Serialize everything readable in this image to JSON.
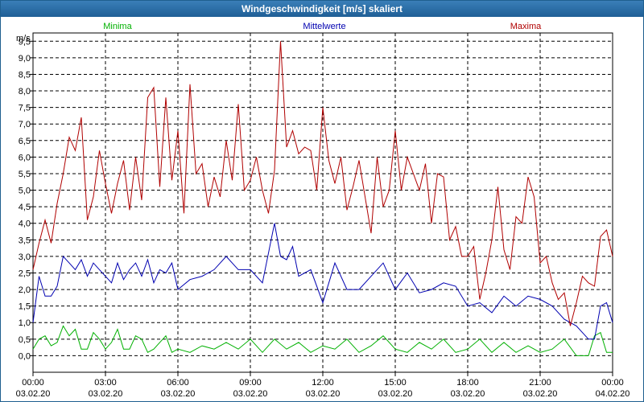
{
  "window": {
    "title": "Windgeschwindigkeit [m/s] skaliert"
  },
  "chart_data": {
    "type": "line",
    "title": "Windgeschwindigkeit [m/s] skaliert",
    "ylabel": "m/s",
    "xlabel": "",
    "ylim": [
      -0.5,
      9.75
    ],
    "xlim": [
      0,
      24
    ],
    "grid": true,
    "legend_placement": "top",
    "y_ticks": [
      "0,0",
      "0,5",
      "1,0",
      "1,5",
      "2,0",
      "2,5",
      "3,0",
      "3,5",
      "4,0",
      "4,5",
      "5,0",
      "5,5",
      "6,0",
      "6,5",
      "7,0",
      "7,5",
      "8,0",
      "8,5",
      "9,0",
      "9,5"
    ],
    "x_ticks": [
      {
        "time": "00:00",
        "date": "03.02.20"
      },
      {
        "time": "03:00",
        "date": "03.02.20"
      },
      {
        "time": "06:00",
        "date": "03.02.20"
      },
      {
        "time": "09:00",
        "date": "03.02.20"
      },
      {
        "time": "12:00",
        "date": "03.02.20"
      },
      {
        "time": "15:00",
        "date": "03.02.20"
      },
      {
        "time": "18:00",
        "date": "03.02.20"
      },
      {
        "time": "21:00",
        "date": "03.02.20"
      },
      {
        "time": "00:00",
        "date": "04.02.20"
      }
    ],
    "series": [
      {
        "name": "Minima",
        "color": "#00b000",
        "x": [
          0,
          0.25,
          0.5,
          0.75,
          1,
          1.25,
          1.5,
          1.75,
          2,
          2.25,
          2.5,
          2.75,
          3,
          3.25,
          3.5,
          3.75,
          4,
          4.25,
          4.5,
          4.75,
          5,
          5.25,
          5.5,
          5.75,
          6,
          6.5,
          7,
          7.5,
          8,
          8.5,
          9,
          9.5,
          10,
          10.5,
          11,
          11.5,
          12,
          12.5,
          13,
          13.5,
          14,
          14.5,
          15,
          15.5,
          16,
          16.5,
          17,
          17.5,
          18,
          18.5,
          19,
          19.5,
          20,
          20.5,
          21,
          21.5,
          22,
          22.5,
          23,
          23.25,
          23.5,
          23.75,
          24
        ],
        "y": [
          0.2,
          0.5,
          0.6,
          0.3,
          0.4,
          0.9,
          0.6,
          0.8,
          0.2,
          0.2,
          0.7,
          0.5,
          0.2,
          0.4,
          0.8,
          0.2,
          0.2,
          0.6,
          0.5,
          0.1,
          0.2,
          0.4,
          0.6,
          0.1,
          0.2,
          0.1,
          0.3,
          0.2,
          0.4,
          0.2,
          0.5,
          0.1,
          0.5,
          0.2,
          0.4,
          0.1,
          0.3,
          0.2,
          0.5,
          0.1,
          0.3,
          0.6,
          0.2,
          0.1,
          0.4,
          0.2,
          0.5,
          0.1,
          0.2,
          0.5,
          0.1,
          0.4,
          0.1,
          0.3,
          0.1,
          0.2,
          0.5,
          0.0,
          0.0,
          0.6,
          0.7,
          0.1,
          0.1
        ]
      },
      {
        "name": "Mittelwerte",
        "color": "#0000b0",
        "x": [
          0,
          0.25,
          0.5,
          0.75,
          1,
          1.25,
          1.5,
          1.75,
          2,
          2.25,
          2.5,
          2.75,
          3,
          3.25,
          3.5,
          3.75,
          4,
          4.25,
          4.5,
          4.75,
          5,
          5.25,
          5.5,
          5.75,
          6,
          6.5,
          7,
          7.5,
          8,
          8.5,
          9,
          9.5,
          10,
          10.25,
          10.5,
          10.75,
          11,
          11.5,
          12,
          12.5,
          13,
          13.5,
          14,
          14.5,
          15,
          15.5,
          16,
          16.5,
          17,
          17.5,
          18,
          18.5,
          19,
          19.5,
          20,
          20.5,
          21,
          21.5,
          22,
          22.5,
          23,
          23.25,
          23.5,
          23.75,
          24
        ],
        "y": [
          1.0,
          2.4,
          1.8,
          1.8,
          2.1,
          3.0,
          2.8,
          2.6,
          2.9,
          2.4,
          2.8,
          2.6,
          2.4,
          2.2,
          2.8,
          2.3,
          2.6,
          2.8,
          2.4,
          2.9,
          2.2,
          2.6,
          2.5,
          2.8,
          2.0,
          2.3,
          2.4,
          2.6,
          3.0,
          2.6,
          2.6,
          2.2,
          4.0,
          3.0,
          2.9,
          3.3,
          2.4,
          2.6,
          1.6,
          2.8,
          2.0,
          2.0,
          2.4,
          2.8,
          2.0,
          2.5,
          1.9,
          2.0,
          2.2,
          2.1,
          1.5,
          1.6,
          1.3,
          1.8,
          1.5,
          1.8,
          1.7,
          1.5,
          1.1,
          0.9,
          0.5,
          0.5,
          1.5,
          1.6,
          1.0
        ]
      },
      {
        "name": "Maxima",
        "color": "#b00000",
        "x": [
          0,
          0.25,
          0.5,
          0.75,
          1,
          1.25,
          1.5,
          1.75,
          2,
          2.25,
          2.5,
          2.75,
          3,
          3.25,
          3.5,
          3.75,
          4,
          4.25,
          4.5,
          4.75,
          5,
          5.25,
          5.5,
          5.75,
          6,
          6.25,
          6.5,
          6.75,
          7,
          7.25,
          7.5,
          7.75,
          8,
          8.25,
          8.5,
          8.75,
          9,
          9.25,
          9.5,
          9.75,
          10,
          10.25,
          10.5,
          10.75,
          11,
          11.25,
          11.5,
          11.75,
          12,
          12.25,
          12.5,
          12.75,
          13,
          13.25,
          13.5,
          13.75,
          14,
          14.25,
          14.5,
          14.75,
          15,
          15.25,
          15.5,
          15.75,
          16,
          16.25,
          16.5,
          16.75,
          17,
          17.25,
          17.5,
          17.75,
          18,
          18.25,
          18.5,
          18.75,
          19,
          19.25,
          19.5,
          19.75,
          20,
          20.25,
          20.5,
          20.75,
          21,
          21.25,
          21.5,
          21.75,
          22,
          22.25,
          22.5,
          22.75,
          23,
          23.25,
          23.5,
          23.75,
          24
        ],
        "y": [
          2.6,
          3.4,
          4.1,
          3.4,
          4.6,
          5.5,
          6.6,
          6.2,
          7.2,
          4.1,
          4.8,
          6.2,
          5.2,
          4.3,
          5.2,
          5.9,
          4.4,
          6.0,
          4.7,
          7.8,
          8.1,
          5.1,
          7.8,
          5.3,
          6.8,
          4.3,
          8.2,
          5.5,
          5.8,
          4.5,
          5.4,
          4.8,
          6.5,
          5.3,
          7.6,
          5.0,
          5.3,
          6.0,
          5.0,
          4.3,
          5.6,
          9.5,
          6.3,
          6.8,
          6.1,
          6.3,
          6.2,
          5.0,
          7.5,
          5.9,
          5.2,
          6.0,
          4.4,
          5.1,
          5.9,
          4.8,
          3.7,
          6.0,
          4.5,
          5.0,
          6.8,
          5.0,
          6.0,
          5.5,
          5.0,
          5.8,
          4.0,
          5.5,
          5.4,
          3.5,
          3.9,
          3.0,
          3.0,
          3.3,
          1.7,
          2.5,
          3.5,
          5.1,
          3.2,
          2.6,
          4.2,
          4.0,
          5.4,
          4.8,
          2.8,
          3.0,
          2.2,
          1.7,
          1.9,
          0.9,
          1.6,
          2.4,
          2.2,
          2.1,
          3.6,
          3.8,
          3.0
        ]
      }
    ]
  }
}
